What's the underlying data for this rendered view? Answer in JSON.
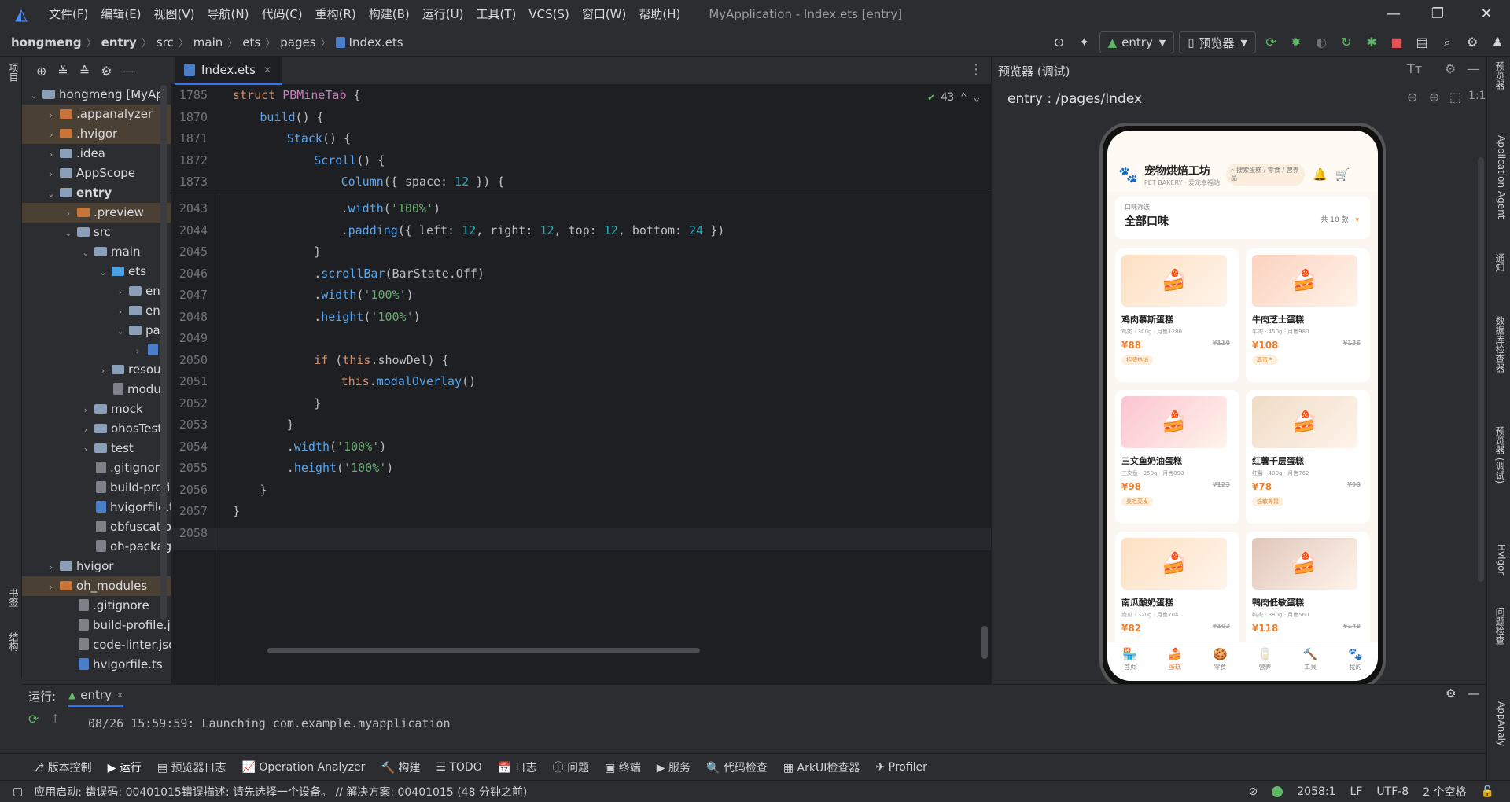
{
  "window": {
    "menu": [
      "文件(F)",
      "编辑(E)",
      "视图(V)",
      "导航(N)",
      "代码(C)",
      "重构(R)",
      "构建(B)",
      "运行(U)",
      "工具(T)",
      "VCS(S)",
      "窗口(W)",
      "帮助(H)"
    ],
    "title": "MyApplication - Index.ets [entry]"
  },
  "breadcrumb": [
    "hongmeng",
    "entry",
    "src",
    "main",
    "ets",
    "pages",
    "Index.ets"
  ],
  "toolbar": {
    "module": "entry",
    "device": "预览器"
  },
  "left_stripe": {
    "project": "项目",
    "bookmarks": "书签",
    "structure": "结构"
  },
  "project": {
    "items": [
      {
        "label": "hongmeng [MyAp",
        "depth": 0,
        "type": "folder",
        "open": true
      },
      {
        "label": ".appanalyzer",
        "depth": 1,
        "type": "folder-orange",
        "hl": "hl-orange"
      },
      {
        "label": ".hvigor",
        "depth": 1,
        "type": "folder-orange",
        "hl": "hl-orange"
      },
      {
        "label": ".idea",
        "depth": 1,
        "type": "folder"
      },
      {
        "label": "AppScope",
        "depth": 1,
        "type": "folder"
      },
      {
        "label": "entry",
        "depth": 1,
        "type": "folder",
        "open": true,
        "bold": true
      },
      {
        "label": ".preview",
        "depth": 2,
        "type": "folder-orange",
        "hl": "hl-orange"
      },
      {
        "label": "src",
        "depth": 2,
        "type": "folder",
        "open": true
      },
      {
        "label": "main",
        "depth": 3,
        "type": "folder",
        "open": true
      },
      {
        "label": "ets",
        "depth": 4,
        "type": "folder-blue",
        "open": true
      },
      {
        "label": "ent",
        "depth": 5,
        "type": "folder"
      },
      {
        "label": "ent",
        "depth": 5,
        "type": "folder"
      },
      {
        "label": "pag",
        "depth": 5,
        "type": "folder",
        "open": true
      },
      {
        "label": "",
        "depth": 6,
        "type": "file-ts"
      },
      {
        "label": "resou",
        "depth": 4,
        "type": "folder"
      },
      {
        "label": "modu",
        "depth": 4,
        "type": "file",
        "noarrow": true
      },
      {
        "label": "mock",
        "depth": 3,
        "type": "folder"
      },
      {
        "label": "ohosTest",
        "depth": 3,
        "type": "folder"
      },
      {
        "label": "test",
        "depth": 3,
        "type": "folder"
      },
      {
        "label": ".gitignore",
        "depth": 3,
        "type": "file",
        "noarrow": true
      },
      {
        "label": "build-profile",
        "depth": 3,
        "type": "file",
        "noarrow": true
      },
      {
        "label": "hvigorfile.ts",
        "depth": 3,
        "type": "file-ts",
        "noarrow": true
      },
      {
        "label": "obfuscation-",
        "depth": 3,
        "type": "file",
        "noarrow": true
      },
      {
        "label": "oh-package.",
        "depth": 3,
        "type": "file",
        "noarrow": true
      },
      {
        "label": "hvigor",
        "depth": 1,
        "type": "folder"
      },
      {
        "label": "oh_modules",
        "depth": 1,
        "type": "folder-orange",
        "hl": "hl-orange"
      },
      {
        "label": ".gitignore",
        "depth": 2,
        "type": "file",
        "noarrow": true
      },
      {
        "label": "build-profile.jsc",
        "depth": 2,
        "type": "file",
        "noarrow": true
      },
      {
        "label": "code-linter.json",
        "depth": 2,
        "type": "file",
        "noarrow": true
      },
      {
        "label": "hvigorfile.ts",
        "depth": 2,
        "type": "file-ts",
        "noarrow": true
      }
    ]
  },
  "editor": {
    "tab": "Index.ets",
    "inspection_count": "43",
    "sticky": [
      {
        "num": "1785",
        "indent": 0,
        "tokens": [
          [
            "kw",
            "struct "
          ],
          [
            "cls",
            "PBMineTab"
          ],
          [
            "ident",
            " {"
          ]
        ]
      },
      {
        "num": "1870",
        "indent": 2,
        "tokens": [
          [
            "fn",
            "build"
          ],
          [
            "ident",
            "() {"
          ]
        ]
      },
      {
        "num": "1871",
        "indent": 4,
        "tokens": [
          [
            "fn",
            "Stack"
          ],
          [
            "ident",
            "() {"
          ]
        ]
      },
      {
        "num": "1872",
        "indent": 6,
        "tokens": [
          [
            "fn",
            "Scroll"
          ],
          [
            "ident",
            "() {"
          ]
        ]
      },
      {
        "num": "1873",
        "indent": 8,
        "tokens": [
          [
            "fn",
            "Column"
          ],
          [
            "ident",
            "({ space: "
          ],
          [
            "num",
            "12"
          ],
          [
            "ident",
            " }) {"
          ]
        ]
      }
    ],
    "lines": [
      {
        "num": "2043",
        "indent": 8,
        "tokens": [
          [
            "ident",
            "."
          ],
          [
            "fn",
            "width"
          ],
          [
            "ident",
            "("
          ],
          [
            "str",
            "'100%'"
          ],
          [
            "ident",
            ")"
          ]
        ]
      },
      {
        "num": "2044",
        "indent": 8,
        "tokens": [
          [
            "ident",
            "."
          ],
          [
            "fn",
            "padding"
          ],
          [
            "ident",
            "({ left: "
          ],
          [
            "num",
            "12"
          ],
          [
            "ident",
            ", right: "
          ],
          [
            "num",
            "12"
          ],
          [
            "ident",
            ", top: "
          ],
          [
            "num",
            "12"
          ],
          [
            "ident",
            ", bottom: "
          ],
          [
            "num",
            "24"
          ],
          [
            "ident",
            " })"
          ]
        ]
      },
      {
        "num": "2045",
        "indent": 6,
        "tokens": [
          [
            "ident",
            "}"
          ]
        ]
      },
      {
        "num": "2046",
        "indent": 6,
        "tokens": [
          [
            "ident",
            "."
          ],
          [
            "fn",
            "scrollBar"
          ],
          [
            "ident",
            "(BarState.Off)"
          ]
        ]
      },
      {
        "num": "2047",
        "indent": 6,
        "tokens": [
          [
            "ident",
            "."
          ],
          [
            "fn",
            "width"
          ],
          [
            "ident",
            "("
          ],
          [
            "str",
            "'100%'"
          ],
          [
            "ident",
            ")"
          ]
        ]
      },
      {
        "num": "2048",
        "indent": 6,
        "tokens": [
          [
            "ident",
            "."
          ],
          [
            "fn",
            "height"
          ],
          [
            "ident",
            "("
          ],
          [
            "str",
            "'100%'"
          ],
          [
            "ident",
            ")"
          ]
        ]
      },
      {
        "num": "2049",
        "indent": 0,
        "tokens": []
      },
      {
        "num": "2050",
        "indent": 6,
        "tokens": [
          [
            "kw",
            "if "
          ],
          [
            "ident",
            "("
          ],
          [
            "kw",
            "this"
          ],
          [
            "ident",
            ".showDel) {"
          ]
        ]
      },
      {
        "num": "2051",
        "indent": 8,
        "tokens": [
          [
            "kw",
            "this"
          ],
          [
            "ident",
            "."
          ],
          [
            "fn",
            "modalOverlay"
          ],
          [
            "ident",
            "()"
          ]
        ]
      },
      {
        "num": "2052",
        "indent": 6,
        "tokens": [
          [
            "ident",
            "}"
          ]
        ]
      },
      {
        "num": "2053",
        "indent": 4,
        "tokens": [
          [
            "ident",
            "}"
          ]
        ]
      },
      {
        "num": "2054",
        "indent": 4,
        "tokens": [
          [
            "ident",
            "."
          ],
          [
            "fn",
            "width"
          ],
          [
            "ident",
            "("
          ],
          [
            "str",
            "'100%'"
          ],
          [
            "ident",
            ")"
          ]
        ]
      },
      {
        "num": "2055",
        "indent": 4,
        "tokens": [
          [
            "ident",
            "."
          ],
          [
            "fn",
            "height"
          ],
          [
            "ident",
            "("
          ],
          [
            "str",
            "'100%'"
          ],
          [
            "ident",
            ")"
          ]
        ]
      },
      {
        "num": "2056",
        "indent": 2,
        "tokens": [
          [
            "ident",
            "}"
          ]
        ]
      },
      {
        "num": "2057",
        "indent": 0,
        "tokens": [
          [
            "ident",
            "}"
          ]
        ]
      },
      {
        "num": "2058",
        "indent": 0,
        "tokens": []
      }
    ]
  },
  "preview": {
    "header": "预览器 (调试)",
    "path": "entry : /pages/Index",
    "zoom_label": "1:1",
    "app": {
      "title": "宠物烘焙工坊",
      "subtitle": "PET BAKERY · 爱宠幸福站",
      "search": "搜索蛋糕 / 零食 / 营养品",
      "filter_small": "口味筛选",
      "filter_big": "全部口味",
      "filter_count": "共 10 款",
      "products": [
        {
          "name": "鸡肉慕斯蛋糕",
          "meta": "鸡肉 · 300g · 月售1280",
          "price": "¥88",
          "old": "¥110",
          "tag": "招牌热销",
          "color": "#fde0c2"
        },
        {
          "name": "牛肉芝士蛋糕",
          "meta": "牛肉 · 450g · 月售980",
          "price": "¥108",
          "old": "¥135",
          "tag": "高蛋白",
          "color": "#fcd2bf"
        },
        {
          "name": "三文鱼奶油蛋糕",
          "meta": "三文鱼 · 350g · 月售890",
          "price": "¥98",
          "old": "¥123",
          "tag": "美毛亮发",
          "color": "#fcc4d2"
        },
        {
          "name": "红薯千层蛋糕",
          "meta": "红薯 · 400g · 月售762",
          "price": "¥78",
          "old": "¥98",
          "tag": "低敏养胃",
          "color": "#efdcc6"
        },
        {
          "name": "南瓜酸奶蛋糕",
          "meta": "南瓜 · 320g · 月售704",
          "price": "¥82",
          "old": "¥103",
          "tag": "",
          "color": "#fde0c2"
        },
        {
          "name": "鸭肉低敏蛋糕",
          "meta": "鸭肉 · 380g · 月售560",
          "price": "¥118",
          "old": "¥148",
          "tag": "",
          "color": "#e0c6bb"
        }
      ],
      "tabs": [
        {
          "icon": "🏪",
          "label": "首页"
        },
        {
          "icon": "🍰",
          "label": "蛋糕",
          "active": true
        },
        {
          "icon": "🍪",
          "label": "零食"
        },
        {
          "icon": "🥛",
          "label": "营养"
        },
        {
          "icon": "🔨",
          "label": "工具"
        },
        {
          "icon": "🐾",
          "label": "我的"
        }
      ]
    }
  },
  "right_stripe": [
    "预览器",
    "Application Agent",
    "通知",
    "数据库检查器",
    "预览器 (调试)",
    "Hvigor",
    "问题检查",
    "AppAnaly"
  ],
  "run": {
    "label": "运行:",
    "tab": "entry",
    "output": "08/26 15:59:59: Launching com.example.myapplication"
  },
  "tool_bar": [
    "版本控制",
    "运行",
    "预览器日志",
    "Operation Analyzer",
    "构建",
    "TODO",
    "日志",
    "问题",
    "终端",
    "服务",
    "代码检查",
    "ArkUI检查器",
    "Profiler"
  ],
  "status": {
    "message": "应用启动: 错误码: 00401015错误描述: 请先选择一个设备。 // 解决方案: 00401015 (48 分钟之前)",
    "position": "2058:1",
    "line_sep": "LF",
    "encoding": "UTF-8",
    "indent": "2 个空格"
  }
}
